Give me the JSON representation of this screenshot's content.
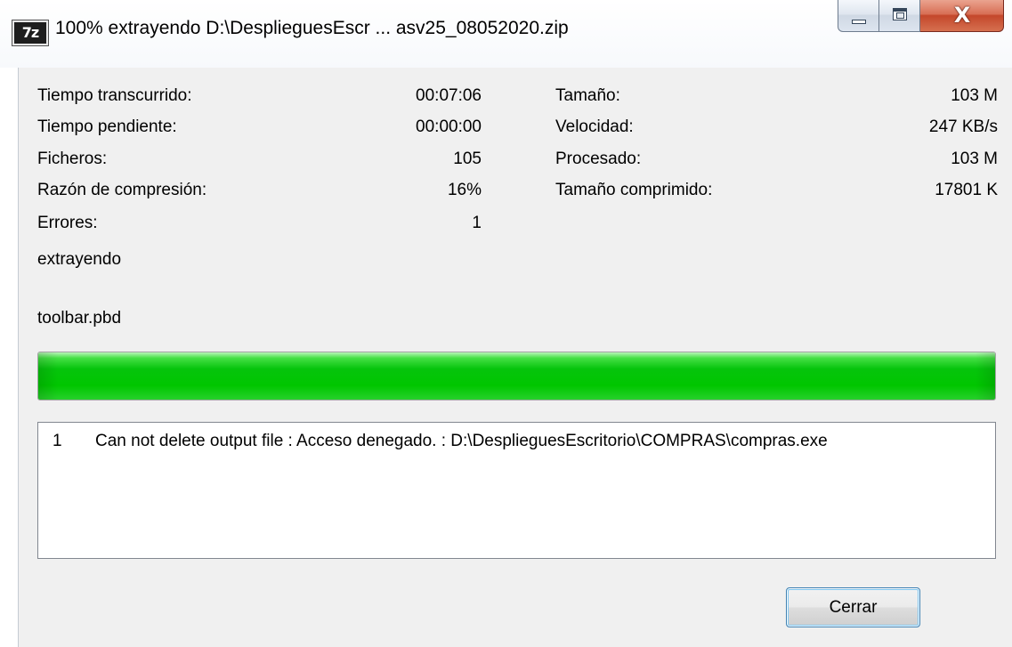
{
  "window": {
    "app_icon_text": "7z",
    "title": "100% extrayendo D:\\DesplieguesEscr ... asv25_08052020.zip",
    "close_glyph": "X"
  },
  "stats": {
    "left": [
      {
        "label": "Tiempo transcurrido:",
        "value": "00:07:06"
      },
      {
        "label": "Tiempo pendiente:",
        "value": "00:00:00"
      },
      {
        "label": "Ficheros:",
        "value": "105"
      },
      {
        "label": "Razón de compresión:",
        "value": "16%"
      },
      {
        "label": "Errores:",
        "value": "1"
      }
    ],
    "right": [
      {
        "label": "Tamaño:",
        "value": "103 M"
      },
      {
        "label": "Velocidad:",
        "value": "247 KB/s"
      },
      {
        "label": "Procesado:",
        "value": "103 M"
      },
      {
        "label": "Tamaño comprimido:",
        "value": "17801 K"
      }
    ]
  },
  "status": {
    "operation": "extrayendo",
    "current_file": "toolbar.pbd"
  },
  "progress": {
    "percent": 100,
    "color": "#06c40c"
  },
  "errors": [
    {
      "num": "1",
      "message": "Can not delete output file : Acceso denegado. : D:\\DesplieguesEscritorio\\COMPRAS\\compras.exe"
    }
  ],
  "buttons": {
    "close_label": "Cerrar"
  }
}
